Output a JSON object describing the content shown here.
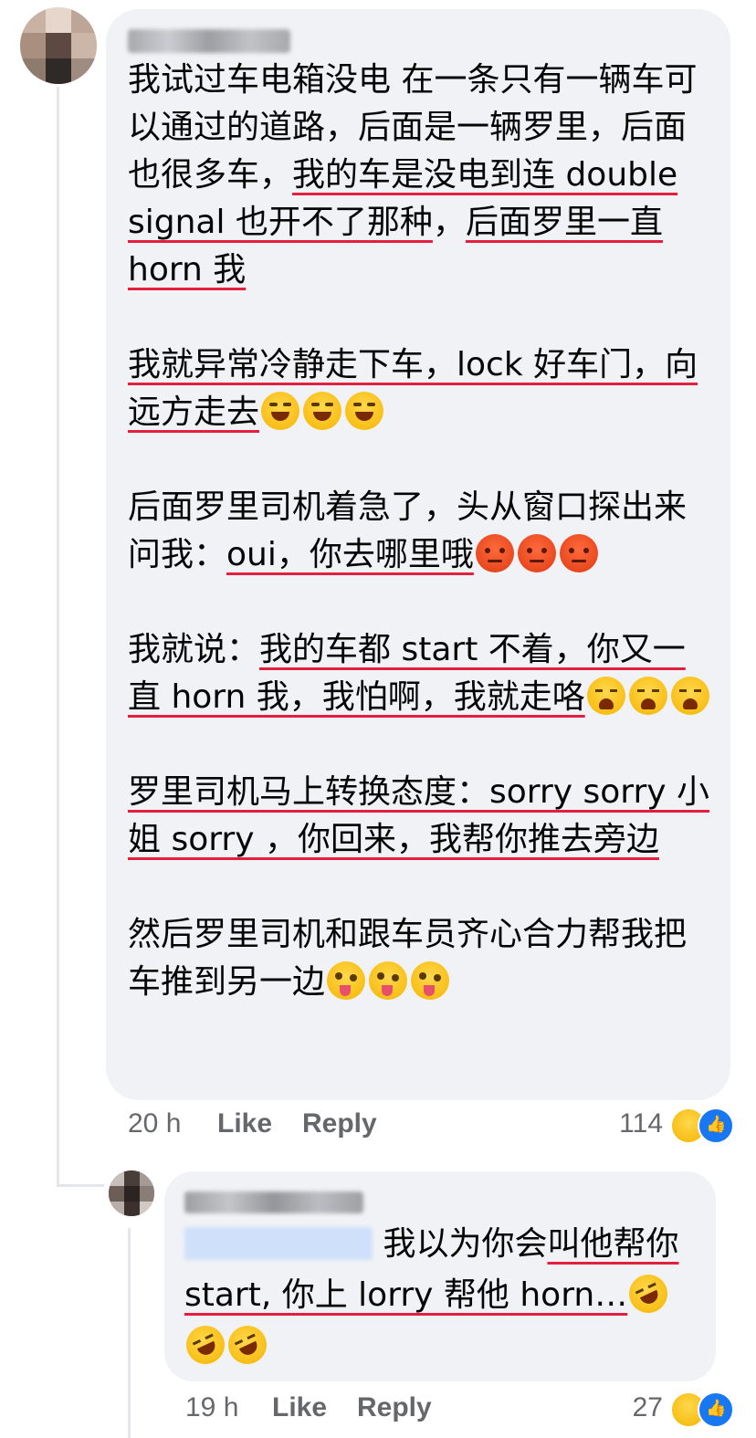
{
  "comment1": {
    "paragraphs": [
      [
        "我试过车电箱没电 在一条只有一辆车可以通过的道路，后面是一辆罗里，后面也很多车，",
        {
          "u": "我的车是没电到连 double signal 也开不了那种"
        },
        "，",
        {
          "u": "后面罗里一直 horn 我"
        }
      ],
      [
        {
          "u": "我就异常冷静走下车，lock 好车门，向远方走去"
        }
      ],
      [
        "后面罗里司机着急了，头从窗口探出来问我：",
        {
          "u": "oui，你去哪里哦"
        }
      ],
      [
        "我就说：",
        {
          "u": "我的车都 start 不着，你又一直 horn 我，我怕啊，我就走咯"
        }
      ],
      [
        {
          "u": "罗里司机马上转换态度：sorry sorry 小姐 sorry ，你回来，我帮你推去旁边"
        }
      ],
      [
        "然后罗里司机和跟车员齐心合力帮我把车推到另一边"
      ]
    ],
    "time": "20 h",
    "like_label": "Like",
    "reply_label": "Reply",
    "reaction_count": "114"
  },
  "reply1": {
    "text_before": "我以为你会",
    "text_u1": "叫他帮你 start, 你上 lorry 帮他 horn…",
    "time": "19 h",
    "like_label": "Like",
    "reply_label": "Reply",
    "reaction_count": "27"
  },
  "icons": {
    "reaction_haha": "haha-icon",
    "reaction_like": "like-icon"
  },
  "colors": {
    "bubble": "#f0f2f5",
    "underline": "#e41e3f",
    "meta": "#65676b",
    "like_blue": "#1877f2"
  }
}
